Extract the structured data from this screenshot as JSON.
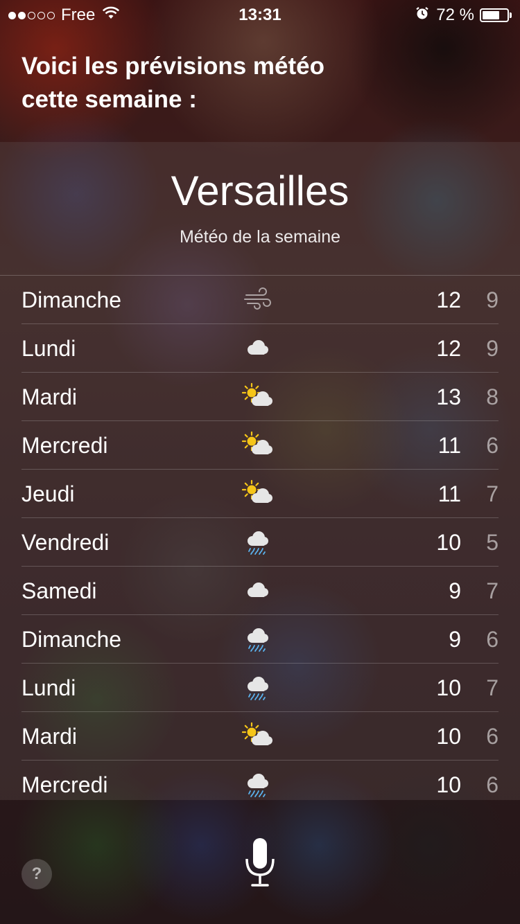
{
  "status_bar": {
    "carrier": "Free",
    "time": "13:31",
    "battery_percent": "72 %",
    "battery_level": 0.72,
    "signal_bars": 2,
    "signal_total": 5,
    "icons": [
      "wifi-icon",
      "alarm-icon",
      "battery-icon"
    ]
  },
  "siri": {
    "line1": "Voici les prévisions météo",
    "line2": "cette semaine :"
  },
  "weather": {
    "city": "Versailles",
    "subtitle": "Météo de la semaine",
    "days": [
      {
        "day": "Dimanche",
        "icon": "wind-icon",
        "high": "12",
        "low": "9"
      },
      {
        "day": "Lundi",
        "icon": "cloud-icon",
        "high": "12",
        "low": "9"
      },
      {
        "day": "Mardi",
        "icon": "partly-sunny-icon",
        "high": "13",
        "low": "8"
      },
      {
        "day": "Mercredi",
        "icon": "partly-sunny-icon",
        "high": "11",
        "low": "6"
      },
      {
        "day": "Jeudi",
        "icon": "partly-sunny-icon",
        "high": "11",
        "low": "7"
      },
      {
        "day": "Vendredi",
        "icon": "rain-icon",
        "high": "10",
        "low": "5"
      },
      {
        "day": "Samedi",
        "icon": "cloud-icon",
        "high": "9",
        "low": "7"
      },
      {
        "day": "Dimanche",
        "icon": "rain-icon",
        "high": "9",
        "low": "6"
      },
      {
        "day": "Lundi",
        "icon": "rain-icon",
        "high": "10",
        "low": "7"
      },
      {
        "day": "Mardi",
        "icon": "partly-sunny-icon",
        "high": "10",
        "low": "6"
      },
      {
        "day": "Mercredi",
        "icon": "rain-icon",
        "high": "10",
        "low": "6"
      }
    ]
  },
  "controls": {
    "help_label": "?"
  },
  "colors": {
    "sun": "#F5C518",
    "rain": "#5BB4F0",
    "cloud": "#E6E6E6"
  }
}
